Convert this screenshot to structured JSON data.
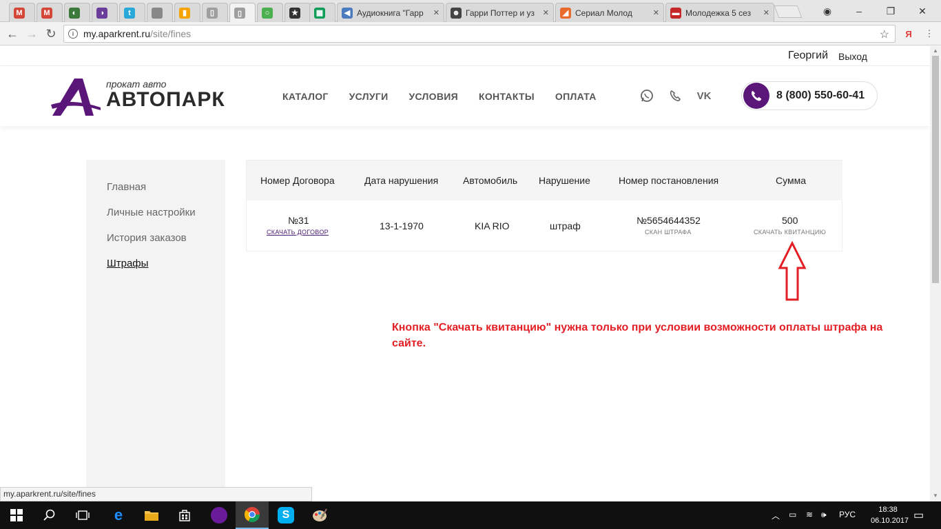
{
  "browser": {
    "tabs": [
      {
        "title": "",
        "icon": "gmail-icon",
        "color": "#d44638",
        "glyph": "M"
      },
      {
        "title": "",
        "icon": "gmail-icon",
        "color": "#d44638",
        "glyph": "M"
      },
      {
        "title": "",
        "icon": "app-icon",
        "color": "#3b7a3b",
        "glyph": "◐"
      },
      {
        "title": "",
        "icon": "app-icon",
        "color": "#6a3d9a",
        "glyph": "◑"
      },
      {
        "title": "",
        "icon": "app-icon",
        "color": "#2aa8d8",
        "glyph": "t"
      },
      {
        "title": "",
        "icon": "apple-icon",
        "color": "#888888",
        "glyph": ""
      },
      {
        "title": "",
        "icon": "analytics-icon",
        "color": "#f4a300",
        "glyph": "▮"
      },
      {
        "title": "",
        "icon": "document-icon",
        "color": "#9e9e9e",
        "glyph": "▯"
      },
      {
        "title": "",
        "icon": "document-icon",
        "color": "#9e9e9e",
        "glyph": "▯"
      },
      {
        "title": "",
        "icon": "app-icon",
        "color": "#4caf50",
        "glyph": "○"
      },
      {
        "title": "",
        "icon": "star-icon",
        "color": "#333333",
        "glyph": "★"
      },
      {
        "title": "",
        "icon": "sheets-icon",
        "color": "#0f9d58",
        "glyph": "▦"
      },
      {
        "title": "Аудиокнига \"Гарр",
        "icon": "megaphone-icon",
        "color": "#4a7bbf",
        "glyph": "◀"
      },
      {
        "title": "Гарри Поттер и уз",
        "icon": "face-icon",
        "color": "#444444",
        "glyph": "☻"
      },
      {
        "title": "Сериал Молод",
        "icon": "app-icon",
        "color": "#e86a2c",
        "glyph": "◢"
      },
      {
        "title": "Молодежка 5 сез",
        "icon": "app-icon",
        "color": "#c62828",
        "glyph": "▬"
      }
    ],
    "url_host": "my.aparkrent.ru",
    "url_path": "/site/fines",
    "ext_label": "Я"
  },
  "userbar": {
    "username": "Георгий",
    "logout": "Выход"
  },
  "header": {
    "logo_tagline": "прокат авто",
    "logo_name": "АВТОПАРК",
    "menu": [
      "КАТАЛОГ",
      "УСЛУГИ",
      "УСЛОВИЯ",
      "КОНТАКТЫ",
      "ОПЛАТА"
    ],
    "phone": "8 (800) 550-60-41"
  },
  "sidebar": {
    "items": [
      "Главная",
      "Личные настройки",
      "История заказов",
      "Штрафы"
    ]
  },
  "fines_table": {
    "headers": [
      "Номер Договора",
      "Дата нарушения",
      "Автомобиль",
      "Нарушение",
      "Номер постановления",
      "Сумма"
    ],
    "row": {
      "contract": "№31",
      "contract_link": "СКАЧАТЬ ДОГОВОР",
      "date": "13-1-1970",
      "car": "KIA RIO",
      "violation": "штраф",
      "resolution": "№5654644352",
      "resolution_link": "СКАН ШТРАФА",
      "amount": "500",
      "amount_link": "СКАЧАТЬ КВИТАНЦИЮ"
    }
  },
  "annotation": {
    "text": "Кнопка \"Скачать квитанцию\" нужна только при условии возможности оплаты штрафа на сайте.",
    "color": "#e31e24"
  },
  "status_bar": "my.aparkrent.ru/site/fines",
  "taskbar": {
    "lang": "РУС",
    "time": "18:38",
    "date": "06.10.2017"
  },
  "colors": {
    "brand": "#5b167a"
  }
}
